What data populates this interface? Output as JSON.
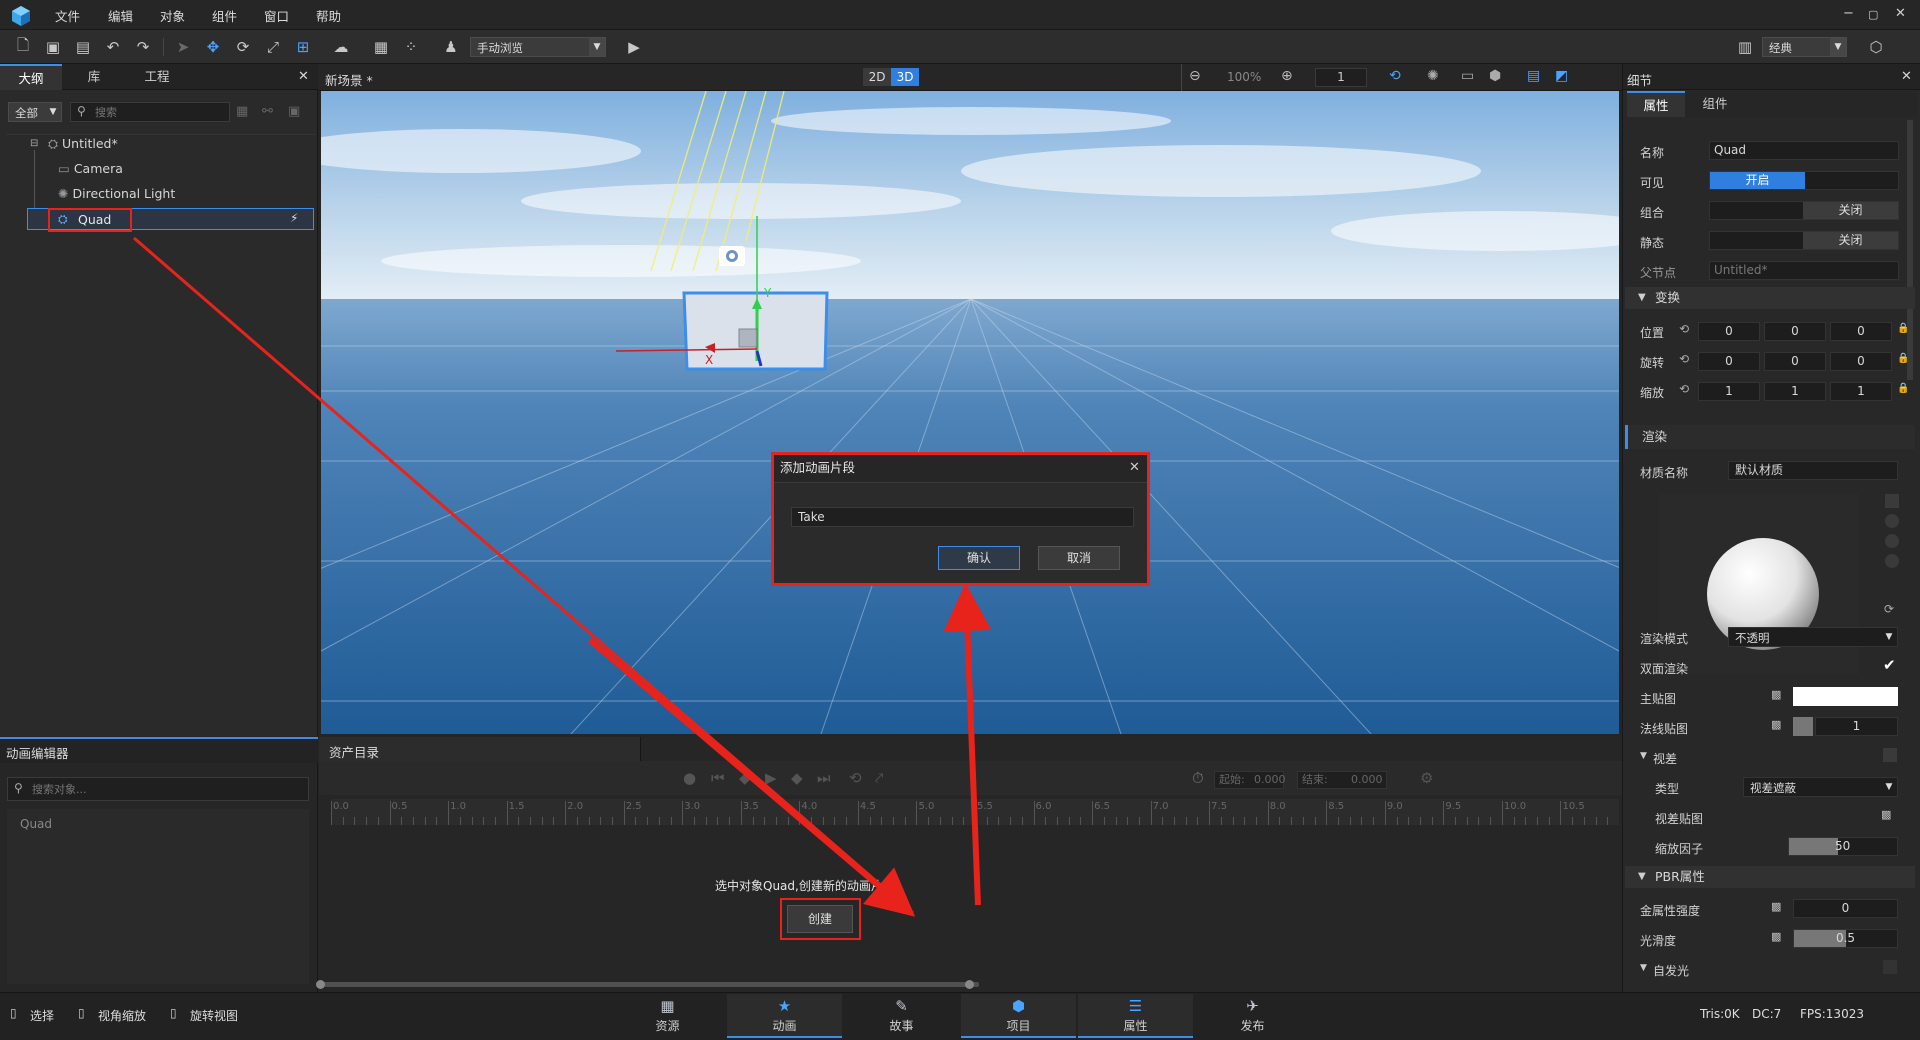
{
  "menubar": {
    "items": [
      "文件",
      "编辑",
      "对象",
      "组件",
      "窗口",
      "帮助"
    ],
    "window_controls": [
      "−",
      "▢",
      "✕"
    ]
  },
  "toolbar": {
    "mode_select": "手动浏览",
    "layout_select": "经典"
  },
  "outline": {
    "tabs": [
      "大纲",
      "库",
      "工程"
    ],
    "filter_select": "全部",
    "search_placeholder": "搜索",
    "tree": [
      {
        "label": "Untitled*",
        "icon": "scene-icon"
      },
      {
        "label": "Camera",
        "icon": "camera-icon"
      },
      {
        "label": "Directional Light",
        "icon": "light-icon"
      },
      {
        "label": "Quad",
        "icon": "quad-icon"
      }
    ]
  },
  "viewport": {
    "scene_title": "新场景 *",
    "view_modes": [
      "2D",
      "3D"
    ],
    "zoom": "100%",
    "count": "1",
    "axis_labels": {
      "x": "X",
      "y": "Y"
    }
  },
  "details": {
    "title": "细节",
    "tabs": [
      "属性",
      "组件"
    ],
    "name_label": "名称",
    "name_value": "Quad",
    "visible_label": "可见",
    "visible_value": "开启",
    "group_label": "组合",
    "group_value": "关闭",
    "static_label": "静态",
    "static_value": "关闭",
    "parent_label": "父节点",
    "parent_value": "Untitled*",
    "transform_section": "变换",
    "position_label": "位置",
    "position": [
      "0",
      "0",
      "0"
    ],
    "rotation_label": "旋转",
    "rotation": [
      "0",
      "0",
      "0"
    ],
    "scale_label": "缩放",
    "scale": [
      "1",
      "1",
      "1"
    ],
    "render_section": "渲染",
    "material_name_label": "材质名称",
    "material_name_value": "默认材质",
    "render_mode_label": "渲染模式",
    "render_mode_value": "不透明",
    "double_sided_label": "双面渲染",
    "main_tex_label": "主贴图",
    "normal_tex_label": "法线贴图",
    "normal_tex_value": "1",
    "parallax_label": "视差",
    "parallax_type_label": "类型",
    "parallax_type_value": "视差遮蔽",
    "parallax_tex_label": "视差贴图",
    "scale_factor_label": "缩放因子",
    "scale_factor_value": "50",
    "scale_factor_fill": 0.45,
    "pbr_section": "PBR属性",
    "metal_label": "金属性强度",
    "metal_value": "0",
    "smooth_label": "光滑度",
    "smooth_value": "0.5",
    "smooth_fill": 0.5,
    "emission_label": "自发光"
  },
  "anim_editor": {
    "title": "动画编辑器",
    "search_placeholder": "搜索对象...",
    "object": "Quad"
  },
  "assets": {
    "title": "资产目录",
    "start_label": "起始:",
    "start_value": "0.000",
    "end_label": "结束:",
    "end_value": "0.000",
    "ruler": [
      "0.0",
      "0.5",
      "1.0",
      "1.5",
      "2.0",
      "2.5",
      "3.0",
      "3.5",
      "4.0",
      "4.5",
      "5.0",
      "5.5",
      "6.0",
      "6.5",
      "7.0",
      "7.5",
      "8.0",
      "8.5",
      "9.0",
      "9.5",
      "10.0",
      "10.5"
    ],
    "hint": "选中对象Quad,创建新的动画片段",
    "create_button": "创建"
  },
  "dialog": {
    "title": "添加动画片段",
    "input_value": "Take",
    "confirm": "确认",
    "cancel": "取消"
  },
  "statusbar": {
    "left_items": [
      "选择",
      "视角缩放",
      "旋转视图"
    ],
    "tabs": [
      "资源",
      "动画",
      "故事",
      "项目",
      "属性",
      "发布"
    ],
    "active_tabs": [
      "动画",
      "项目",
      "属性"
    ],
    "tris": "Tris:0K",
    "dc": "DC:7",
    "fps": "FPS:13023"
  },
  "colors": {
    "accent": "#3c8ee8",
    "annotation": "#e8231c"
  }
}
